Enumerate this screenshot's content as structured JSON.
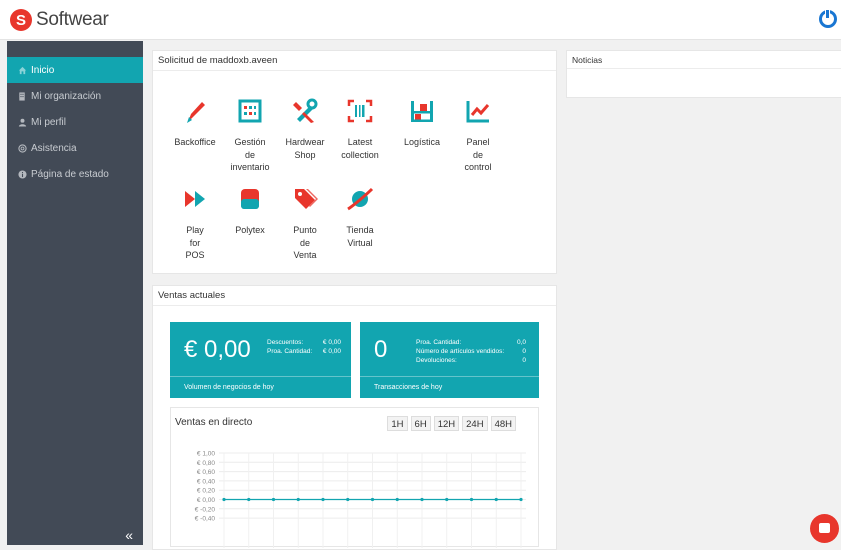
{
  "brand": {
    "logo_letter": "S",
    "name": "Softwear",
    "accent": "#e8362c",
    "teal": "#12a5b0"
  },
  "sidebar": {
    "items": [
      {
        "label": "Inicio",
        "icon": "home-icon",
        "active": true
      },
      {
        "label": "Mi organización",
        "icon": "building-icon"
      },
      {
        "label": "Mi perfil",
        "icon": "user-icon"
      },
      {
        "label": "Asistencia",
        "icon": "lifebuoy-icon"
      },
      {
        "label": "Página de estado",
        "icon": "info-icon"
      }
    ],
    "collapse_label": "«"
  },
  "apps_panel": {
    "title": "Solicitud de maddoxb.aveen",
    "apps": [
      {
        "lines": [
          "Backoffice"
        ],
        "icon": "pen-icon"
      },
      {
        "lines": [
          "Gestión",
          "de",
          "inventario"
        ],
        "icon": "abacus-icon"
      },
      {
        "lines": [
          "Hardwear",
          "Shop"
        ],
        "icon": "tools-icon"
      },
      {
        "lines": [
          "Latest",
          "collection"
        ],
        "icon": "barcode-icon"
      },
      {
        "lines": [
          "Logística"
        ],
        "icon": "shelves-icon"
      },
      {
        "lines": [
          "Panel",
          "de",
          "control"
        ],
        "icon": "chart-line-icon"
      },
      {
        "lines": [
          "Play",
          "for",
          "POS"
        ],
        "icon": "play-icon"
      },
      {
        "lines": [
          "Polytex"
        ],
        "icon": "card-icon"
      },
      {
        "lines": [
          "Punto",
          "de",
          "Venta"
        ],
        "icon": "tag-icon"
      },
      {
        "lines": [
          "Tienda",
          "Virtual"
        ],
        "icon": "planet-icon"
      }
    ]
  },
  "news_panel": {
    "title": "Noticias"
  },
  "sales_panel": {
    "title": "Ventas actuales",
    "revenue_tile": {
      "value": "€ 0,00",
      "details": [
        {
          "label": "Descuentos:",
          "value": "€ 0,00"
        },
        {
          "label": "Proa. Cantidad:",
          "value": "€ 0,00"
        }
      ],
      "footer": "Volumen de negocios de hoy"
    },
    "transactions_tile": {
      "value": "0",
      "details": [
        {
          "label": "Proa. Cantidad:",
          "value": "0,0"
        },
        {
          "label": "Número de artículos vendidos:",
          "value": "0"
        },
        {
          "label": "Devoluciones:",
          "value": "0"
        }
      ],
      "footer": "Transacciones de hoy"
    },
    "live": {
      "title": "Ventas en directo",
      "ranges": [
        "1H",
        "6H",
        "12H",
        "24H",
        "48H"
      ]
    }
  },
  "chart_data": {
    "type": "line",
    "title": "",
    "xlabel": "",
    "ylabel": "",
    "yticks": [
      "€ 1,00",
      "€ 0,80",
      "€ 0,60",
      "€ 0,40",
      "€ 0,20",
      "€ 0,00",
      "€ -0,20",
      "€ -0,40"
    ],
    "ylim": [
      -0.4,
      1.0
    ],
    "grid": true,
    "series": [
      {
        "values": [
          0,
          0,
          0,
          0,
          0,
          0,
          0,
          0,
          0,
          0,
          0,
          0,
          0
        ]
      }
    ]
  }
}
